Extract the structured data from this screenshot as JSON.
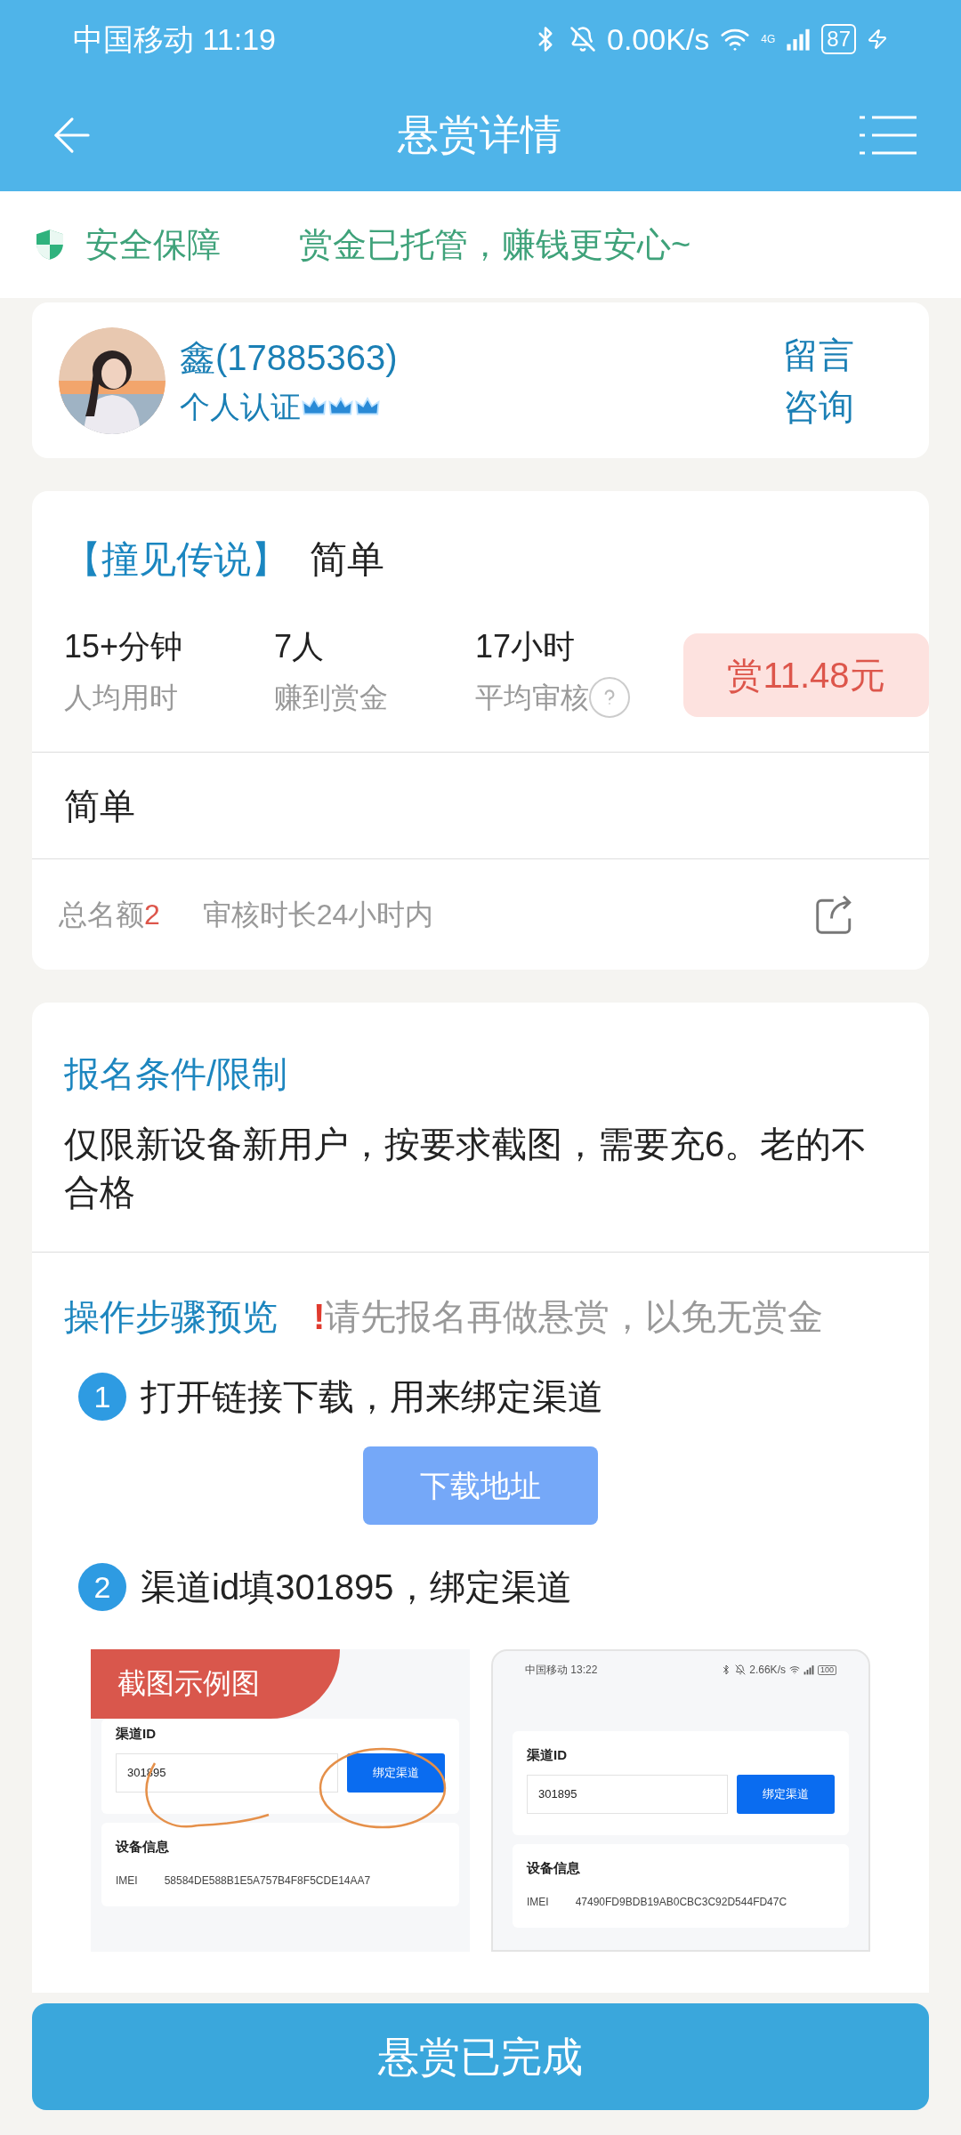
{
  "status_bar": {
    "carrier": "中国移动",
    "time": "11:19",
    "speed": "0.00K/s",
    "network": "4G",
    "battery": "87"
  },
  "header": {
    "title": "悬赏详情"
  },
  "notice": {
    "label": "安全保障",
    "message": "赏金已托管，赚钱更安心~"
  },
  "publisher": {
    "name": "鑫(17885363)",
    "verification": "个人认证",
    "contact": "留言咨询"
  },
  "task": {
    "category": "【撞见传说】",
    "title": "简单",
    "stats": [
      {
        "value": "15+分钟",
        "label": "人均用时",
        "help": false
      },
      {
        "value": "7人",
        "label": "赚到赏金",
        "help": false
      },
      {
        "value": "17小时",
        "label": "平均审核",
        "help": true
      }
    ],
    "reward": "赏11.48元",
    "description": "简单",
    "quota_label": "总名额",
    "quota": "2",
    "review": "审核时长24小时内"
  },
  "conditions": {
    "title": "报名条件/限制",
    "text": "仅限新设备新用户，按要求截图，需要充6。老的不合格"
  },
  "steps": {
    "title": "操作步骤预览",
    "warning_mark": "!",
    "warning": "请先报名再做悬赏，以免无赏金",
    "items": [
      {
        "number": "1",
        "text": "打开链接下载，用来绑定渠道",
        "button": "下载地址"
      },
      {
        "number": "2",
        "text": "渠道id填301895，绑定渠道"
      }
    ]
  },
  "examples": [
    {
      "kind": "annotated",
      "banner": "截图示例图",
      "field_label": "渠道ID",
      "field_value": "301895",
      "button": "绑定渠道",
      "section": "设备信息",
      "imei_label": "IMEI",
      "imei": "58584DE588B1E5A757B4F8F5CDE14AA7"
    },
    {
      "kind": "phone",
      "carrier": "中国移动",
      "time": "13:22",
      "speed": "2.66K/s",
      "battery": "100",
      "field_label": "渠道ID",
      "field_value": "301895",
      "button": "绑定渠道",
      "section": "设备信息",
      "imei_label": "IMEI",
      "imei": "47490FD9BDB19AB0CBC3C92D544FD47C"
    }
  ],
  "footer_button": "悬赏已完成"
}
